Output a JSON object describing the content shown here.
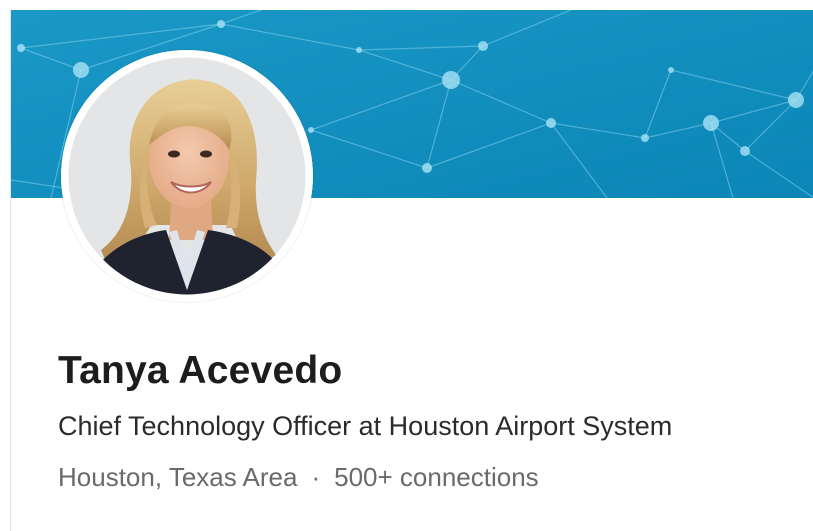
{
  "profile": {
    "name": "Tanya Acevedo",
    "headline": "Chief Technology Officer at Houston Airport System",
    "location": "Houston, Texas Area",
    "separator": "·",
    "connections": "500+ connections"
  },
  "banner": {
    "color": "#0e8fbf",
    "pattern": "network-nodes"
  },
  "avatar": {
    "icon": "profile-photo"
  }
}
